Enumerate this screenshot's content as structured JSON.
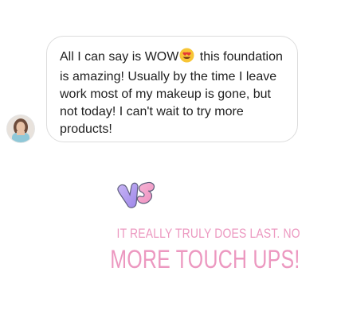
{
  "message": {
    "text_before_emoji": "All I can say is WOW",
    "emoji": "heart-eyes-emoji",
    "text_after_emoji": " this foundation is amazing! Usually by the time I leave work most of my makeup is gone, but not today! I can't wait to try more products!"
  },
  "avatar": {
    "icon": "user-avatar-photo"
  },
  "sticker": {
    "icon": "pastel-letter-sticker",
    "colors": [
      "#b7a5f0",
      "#f2a2c9",
      "#6b6b8a"
    ]
  },
  "caption": {
    "line_1": "IT REALLY TRULY DOES LAST. NO",
    "line_2": "MORE TOUCH UPS!",
    "color": "#ec98c0"
  },
  "colors": {
    "bubble_border": "#dcdcdc",
    "text": "#1f1f1f",
    "background": "#ffffff"
  }
}
